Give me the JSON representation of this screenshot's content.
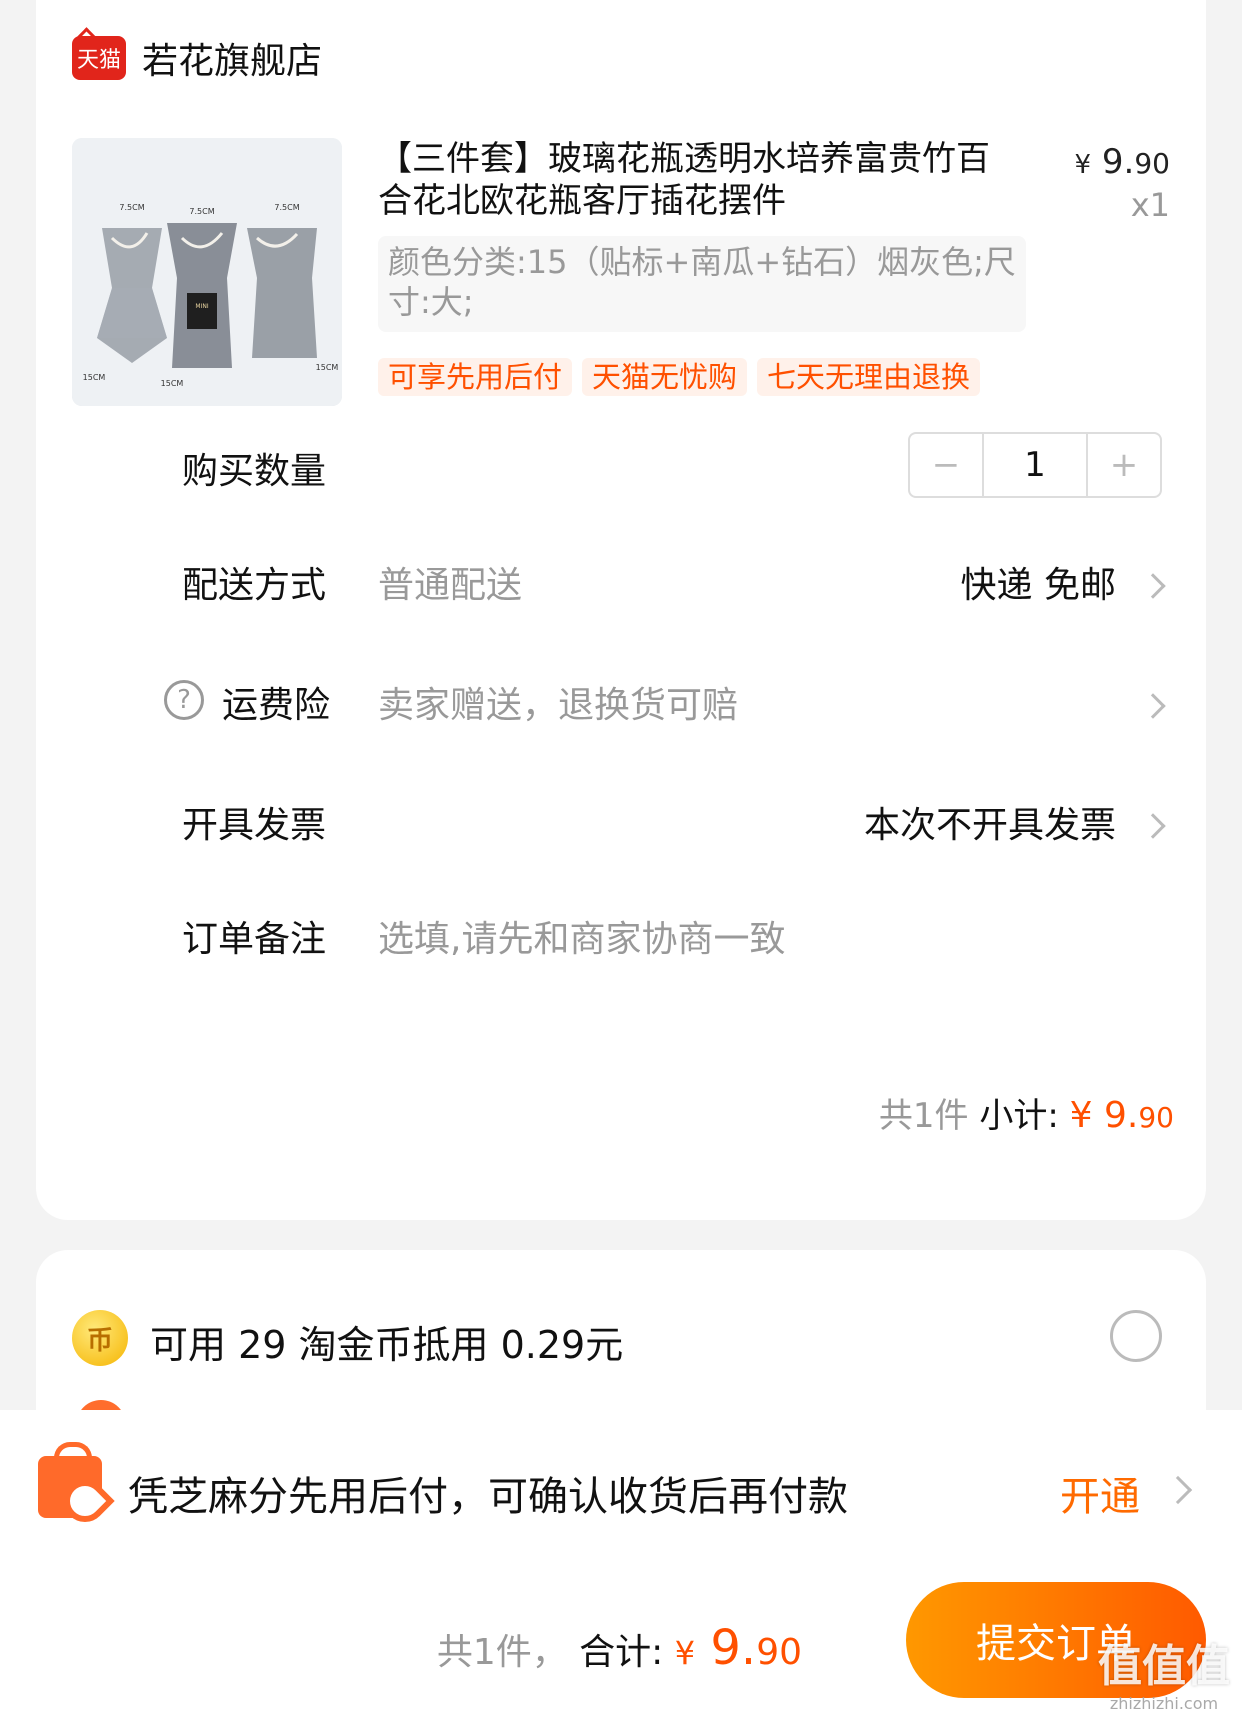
{
  "shop": {
    "logo_text": "天猫",
    "name": "若花旗舰店"
  },
  "product": {
    "title": "【三件套】玻璃花瓶透明水培养富贵竹百合花北欧花瓶客厅插花摆件",
    "price_currency": "¥",
    "price_int": "9.",
    "price_dec": "90",
    "quantity": "x1",
    "sku": "颜色分类:15（贴标+南瓜+钻石）烟灰色;尺寸:大;",
    "tags": [
      "可享先用后付",
      "天猫无忧购",
      "七天无理由退换"
    ],
    "image_labels": [
      "7.5CM",
      "7.5CM",
      "7.5CM",
      "15CM",
      "15CM",
      "15CM",
      "MINI"
    ]
  },
  "quantity_row": {
    "label": "购买数量",
    "minus": "−",
    "value": "1",
    "plus": "+"
  },
  "delivery": {
    "label": "配送方式",
    "method": "普通配送",
    "value": "快递 免邮"
  },
  "insurance": {
    "help": "?",
    "label": "运费险",
    "desc": "卖家赠送，退换货可赔"
  },
  "invoice": {
    "label": "开具发票",
    "value": "本次不开具发票"
  },
  "remark": {
    "label": "订单备注",
    "placeholder": "选填,请先和商家协商一致"
  },
  "subtotal": {
    "count": "共1件",
    "label": "小计:",
    "currency": "¥",
    "int": "9.",
    "dec": "90"
  },
  "coins": {
    "icon": "币",
    "text": "可用 29 淘金币抵用 0.29元"
  },
  "pay_later": {
    "text": "凭芝麻分先用后付，可确认收货后再付款",
    "action": "开通"
  },
  "footer": {
    "count": "共1件，",
    "label": "合计:",
    "currency": "¥",
    "int": " 9.",
    "dec": "90",
    "submit": "提交订单"
  },
  "watermark": {
    "big": "值值值",
    "small": "zhizhizhi.com"
  },
  "colors": {
    "accent": "#ff5000",
    "submit_start": "#ff9800",
    "submit_end": "#ff5a00",
    "tmall_red": "#e1251b"
  }
}
